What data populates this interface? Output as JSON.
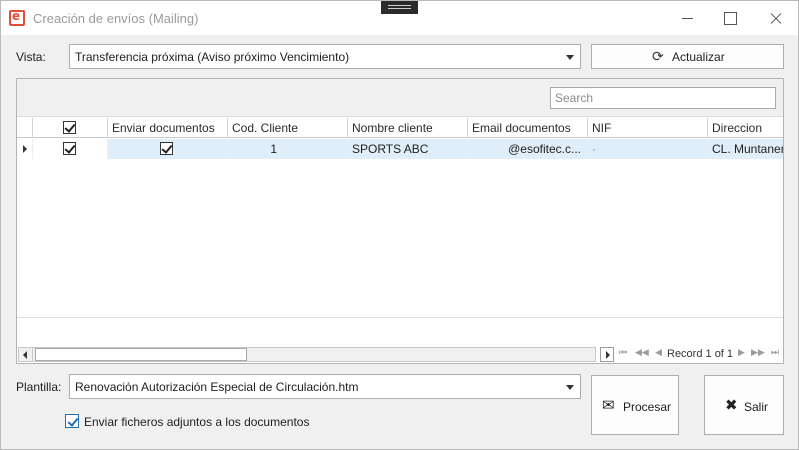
{
  "window": {
    "title": "Creación de envíos (Mailing)"
  },
  "vista": {
    "label": "Vista:",
    "selected": "Transferencia próxima (Aviso próximo Vencimiento)"
  },
  "toolbar": {
    "refresh_label": "Actualizar"
  },
  "grid": {
    "search_placeholder": "Search",
    "columns": [
      "Enviar documentos",
      "Cod. Cliente",
      "Nombre cliente",
      "Email documentos",
      "NIF",
      "Direccion"
    ],
    "rows": [
      {
        "selected": true,
        "enviar_documentos": true,
        "cod_cliente": "1",
        "nombre_cliente": "SPORTS ABC",
        "email_documentos": "@esofitec.c...",
        "nif": "·",
        "direccion": "CL. Muntaner"
      }
    ],
    "header_checked": true,
    "pager_text": "Record 1 of 1"
  },
  "plantilla": {
    "label": "Plantilla:",
    "selected": "Renovación Autorización Especial de Circulación.htm"
  },
  "attach": {
    "label": "Enviar ficheros adjuntos a los documentos",
    "checked": true
  },
  "actions": {
    "process_label": "Procesar",
    "exit_label": "Salir"
  },
  "icons": {
    "app": "app-logo-icon",
    "refresh": "refresh-icon",
    "process": "envelope-icon",
    "exit": "close-icon"
  },
  "colors": {
    "brand": "#e04e39",
    "row_highlight": "#dfeef8",
    "accent_check": "#1f6fb5"
  }
}
